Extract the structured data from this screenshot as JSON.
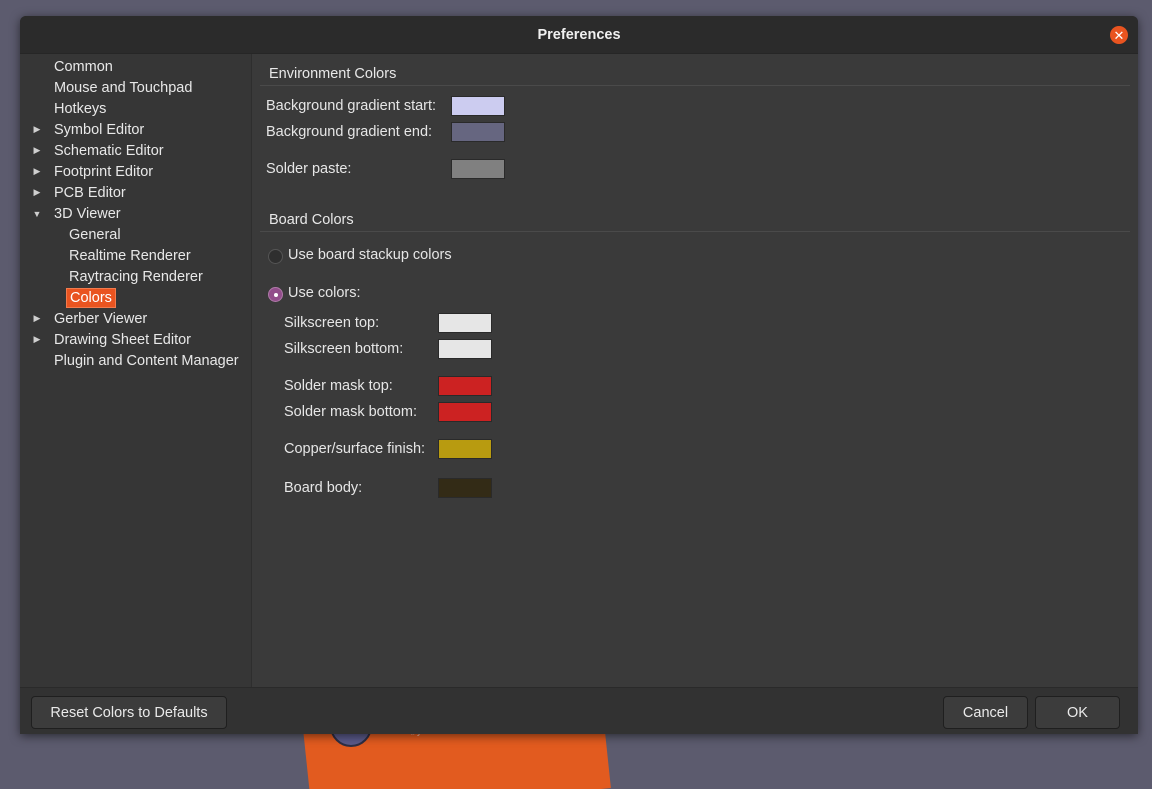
{
  "dialog": {
    "title": "Preferences"
  },
  "sidebar": {
    "items": [
      {
        "label": "Common",
        "arrow": "",
        "level": 0
      },
      {
        "label": "Mouse and Touchpad",
        "arrow": "",
        "level": 0
      },
      {
        "label": "Hotkeys",
        "arrow": "",
        "level": 0
      },
      {
        "label": "Symbol Editor",
        "arrow": "collapsed",
        "level": 0
      },
      {
        "label": "Schematic Editor",
        "arrow": "collapsed",
        "level": 0
      },
      {
        "label": "Footprint Editor",
        "arrow": "collapsed",
        "level": 0
      },
      {
        "label": "PCB Editor",
        "arrow": "collapsed",
        "level": 0
      },
      {
        "label": "3D Viewer",
        "arrow": "expanded",
        "level": 0
      },
      {
        "label": "General",
        "arrow": "",
        "level": 1
      },
      {
        "label": "Realtime Renderer",
        "arrow": "",
        "level": 1
      },
      {
        "label": "Raytracing Renderer",
        "arrow": "",
        "level": 1
      },
      {
        "label": "Colors",
        "arrow": "",
        "level": 1,
        "selected": true
      },
      {
        "label": "Gerber Viewer",
        "arrow": "collapsed",
        "level": 0
      },
      {
        "label": "Drawing Sheet Editor",
        "arrow": "collapsed",
        "level": 0
      },
      {
        "label": "Plugin and Content Manager",
        "arrow": "",
        "level": 0
      }
    ]
  },
  "environment": {
    "title": "Environment Colors",
    "bg_start": {
      "label": "Background gradient start:",
      "color": "#ccccf0"
    },
    "bg_end": {
      "label": "Background gradient end:",
      "color": "#666680"
    },
    "solder_paste": {
      "label": "Solder paste:",
      "color": "#808080"
    }
  },
  "board": {
    "title": "Board Colors",
    "use_stackup": {
      "label": "Use board stackup colors",
      "checked": false
    },
    "use_colors": {
      "label": "Use colors:",
      "checked": true
    },
    "silk_top": {
      "label": "Silkscreen top:",
      "color": "#e6e6e6"
    },
    "silk_bottom": {
      "label": "Silkscreen bottom:",
      "color": "#e6e6e6"
    },
    "mask_top": {
      "label": "Solder mask top:",
      "color": "#cc2222"
    },
    "mask_bottom": {
      "label": "Solder mask bottom:",
      "color": "#cc2222"
    },
    "copper": {
      "label": "Copper/surface finish:",
      "color": "#b89b10"
    },
    "body": {
      "label": "Board body:",
      "color": "#332b16"
    }
  },
  "footer": {
    "reset_label": "Reset Colors to Defaults",
    "cancel_label": "Cancel",
    "ok_label": "OK"
  },
  "background": {
    "caption": "by"
  }
}
